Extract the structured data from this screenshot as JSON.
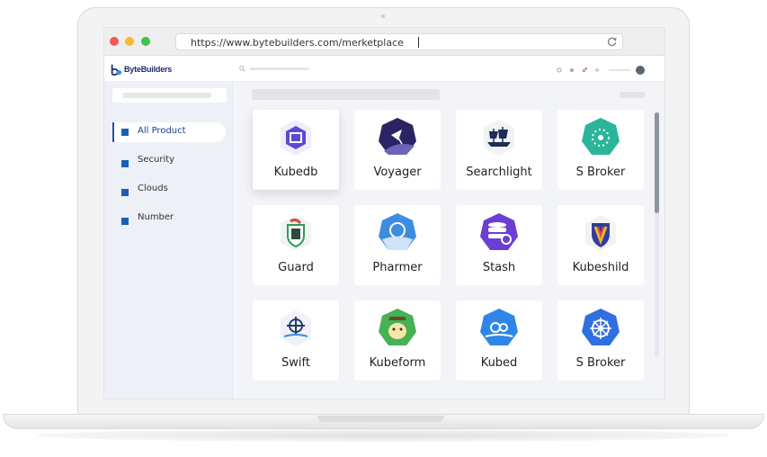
{
  "browser": {
    "url": "https://www.bytebuilders.com/merketplace",
    "reload_icon": "reload-icon"
  },
  "app": {
    "logo_text": "ByteBuilders"
  },
  "sidebar": {
    "items": [
      {
        "label": "All Product",
        "active": true
      },
      {
        "label": "Security",
        "active": false
      },
      {
        "label": "Clouds",
        "active": false
      },
      {
        "label": "Number",
        "active": false
      }
    ]
  },
  "products": [
    {
      "name": "Kubedb",
      "icon": "kubedb-icon",
      "color": "#5c4bd1"
    },
    {
      "name": "Voyager",
      "icon": "voyager-icon",
      "color": "#2a2463"
    },
    {
      "name": "Searchlight",
      "icon": "searchlight-icon",
      "color": "#1e2d52"
    },
    {
      "name": "S Broker",
      "icon": "s-broker-icon",
      "color": "#2bb59a"
    },
    {
      "name": "Guard",
      "icon": "guard-icon",
      "color": "#2e9c57"
    },
    {
      "name": "Pharmer",
      "icon": "pharmer-icon",
      "color": "#3b8de0"
    },
    {
      "name": "Stash",
      "icon": "stash-icon",
      "color": "#6b3fd4"
    },
    {
      "name": "Kubeshild",
      "icon": "kubeshild-icon",
      "color": "#2f3d9c"
    },
    {
      "name": "Swift",
      "icon": "swift-icon",
      "color": "#243a6e"
    },
    {
      "name": "Kubeform",
      "icon": "kubeform-icon",
      "color": "#45b254"
    },
    {
      "name": "Kubed",
      "icon": "kubed-icon",
      "color": "#2f86e8"
    },
    {
      "name": "S Broker",
      "icon": "s-broker-helm-icon",
      "color": "#2f6fe0"
    }
  ],
  "colors": {
    "accent": "#1a5fb4",
    "sidebar_bg": "#edf0f6",
    "main_bg": "#f3f4f8"
  }
}
